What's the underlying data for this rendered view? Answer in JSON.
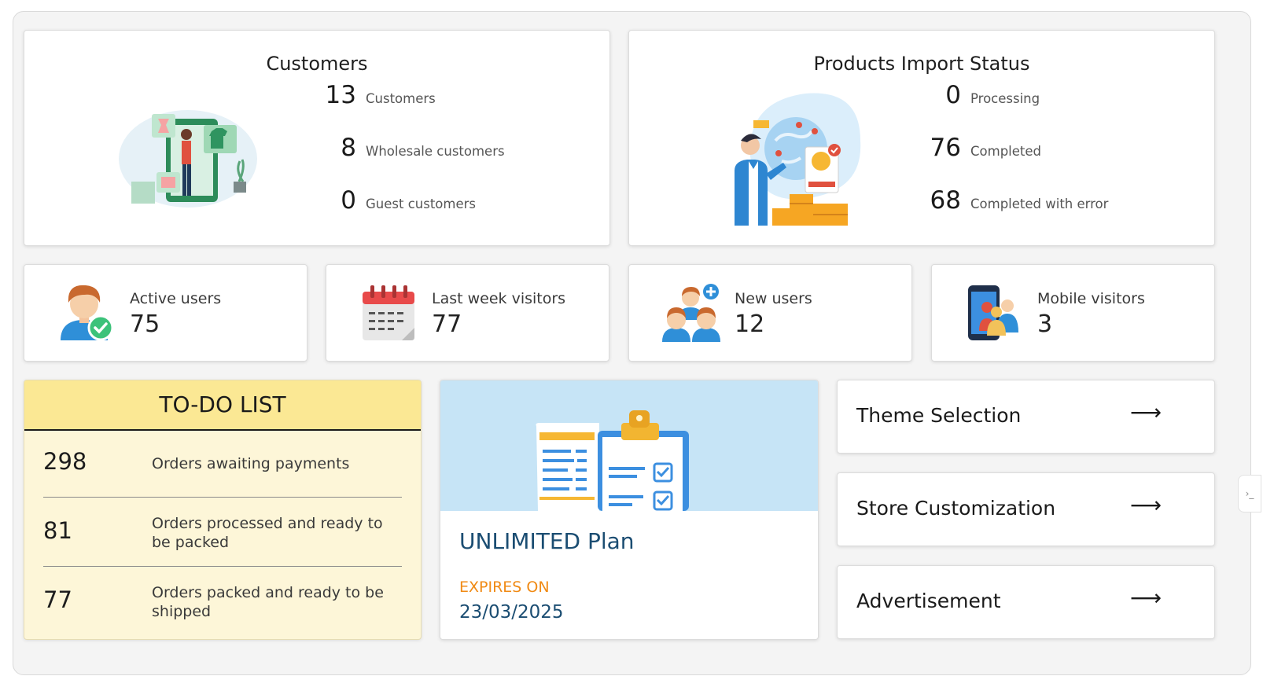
{
  "customers": {
    "title": "Customers",
    "stats": [
      {
        "value": "13",
        "label": "Customers"
      },
      {
        "value": "8",
        "label": "Wholesale customers"
      },
      {
        "value": "0",
        "label": "Guest customers"
      }
    ]
  },
  "import_status": {
    "title": "Products Import Status",
    "stats": [
      {
        "value": "0",
        "label": "Processing"
      },
      {
        "value": "76",
        "label": "Completed"
      },
      {
        "value": "68",
        "label": "Completed with error"
      }
    ]
  },
  "mini_stats": [
    {
      "label": "Active users",
      "value": "75",
      "icon": "active-user-icon"
    },
    {
      "label": "Last week visitors",
      "value": "77",
      "icon": "calendar-icon"
    },
    {
      "label": "New users",
      "value": "12",
      "icon": "new-users-icon"
    },
    {
      "label": "Mobile visitors",
      "value": "3",
      "icon": "mobile-visitors-icon"
    }
  ],
  "todo": {
    "title": "TO-DO LIST",
    "items": [
      {
        "count": "298",
        "text": "Orders awaiting payments"
      },
      {
        "count": "81",
        "text": "Orders processed and ready to be packed"
      },
      {
        "count": "77",
        "text": "Orders packed and ready to be shipped"
      }
    ]
  },
  "plan": {
    "name": "UNLIMITED Plan",
    "expires_label": "EXPIRES ON",
    "expires_date": "23/03/2025"
  },
  "links": [
    {
      "label": "Theme Selection",
      "arrow": "⟶"
    },
    {
      "label": "Store Customization",
      "arrow": "⟶"
    },
    {
      "label": "Advertisement",
      "arrow": "⟶"
    }
  ],
  "edge_tab": {
    "glyph": "›_"
  },
  "colors": {
    "todo_header": "#fbe894",
    "todo_body": "#fdf6d8",
    "plan_banner": "#c6e4f6",
    "plan_text": "#1b4d72",
    "expires": "#f08a14"
  }
}
